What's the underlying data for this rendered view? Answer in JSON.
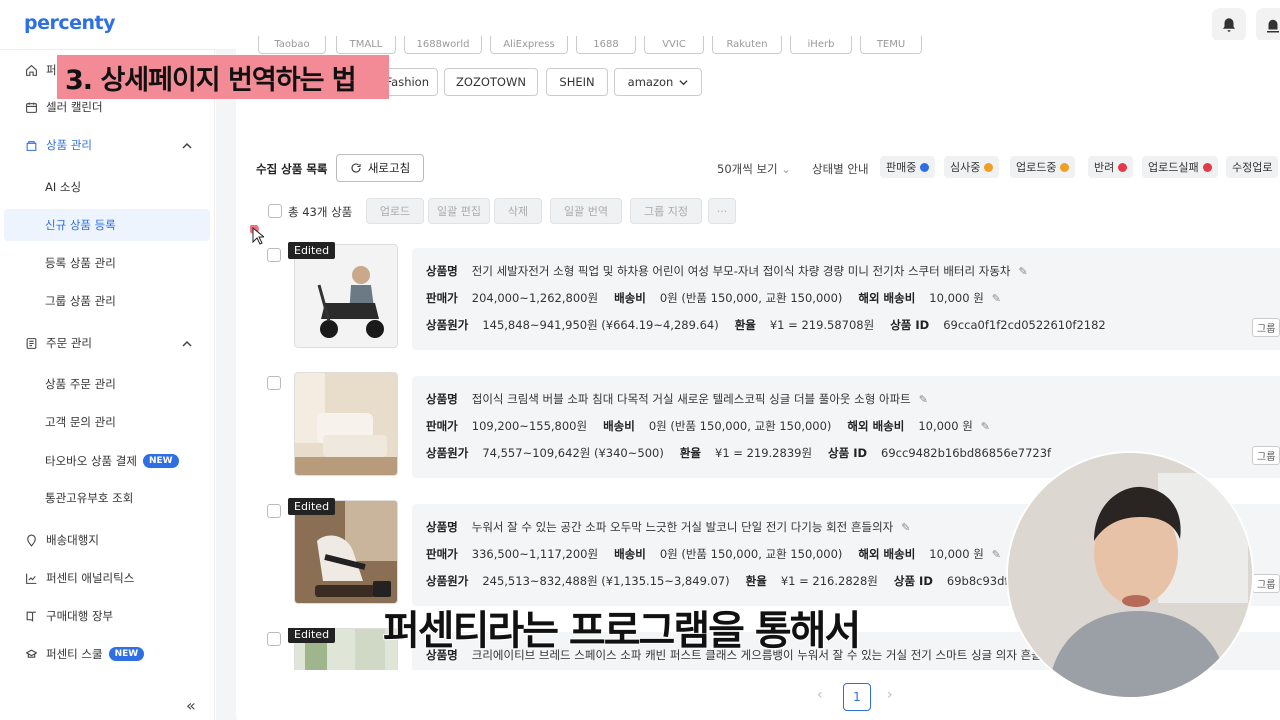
{
  "app": {
    "logo": "percenty"
  },
  "sidebar": {
    "items": [
      {
        "label": "퍼센티 홈",
        "icon": "home-icon"
      },
      {
        "label": "셀러 캘린더",
        "icon": "calendar-icon"
      },
      {
        "label": "상품 관리",
        "icon": "box-icon",
        "active": true
      },
      {
        "label": "AI 소싱"
      },
      {
        "label": "신규 상품 등록",
        "selected": true
      },
      {
        "label": "등록 상품 관리"
      },
      {
        "label": "그룹 상품 관리"
      },
      {
        "label": "주문 관리",
        "icon": "order-icon"
      },
      {
        "label": "상품 주문 관리"
      },
      {
        "label": "고객 문의 관리"
      },
      {
        "label": "타오바오 상품 결제",
        "badge": "NEW"
      },
      {
        "label": "통관고유부호 조회"
      },
      {
        "label": "배송대행지",
        "icon": "pin-icon"
      },
      {
        "label": "퍼센티 애널리틱스",
        "icon": "chart-icon"
      },
      {
        "label": "구매대행 장부",
        "icon": "book-icon"
      },
      {
        "label": "퍼센티 스쿨",
        "icon": "school-icon",
        "badge": "NEW"
      }
    ]
  },
  "filters": {
    "top_chips": [
      "Taobao",
      "TMALL",
      "1688world",
      "AliExpress",
      "1688",
      "VVIC",
      "Rakuten",
      "iHerb",
      "TEMU"
    ],
    "chips": [
      "Fashion",
      "ZOZOTOWN",
      "SHEIN",
      "amazon"
    ]
  },
  "list": {
    "title": "수집 상품 목록",
    "refresh": "새로고침",
    "per_page": "50개씩 보기",
    "status_guide": "상태별 안내",
    "statuses": [
      {
        "label": "판매중",
        "color": "#2f6fe4"
      },
      {
        "label": "심사중",
        "color": "#f0a020"
      },
      {
        "label": "업로드중",
        "color": "#f0a020"
      },
      {
        "label": "반려",
        "color": "#e53948"
      },
      {
        "label": "업로드실패",
        "color": "#e53948"
      },
      {
        "label": "수정업로"
      }
    ],
    "total": "총 43개 상품",
    "bulk_actions": [
      "업로드",
      "일괄 편집",
      "삭제",
      "일괄 번역",
      "그룹 지정",
      "···"
    ]
  },
  "labels": {
    "name": "상품명",
    "price": "판매가",
    "shipping": "배송비",
    "overseas": "해외 배송비",
    "cost": "상품원가",
    "rate": "환율",
    "id": "상품 ID",
    "group": "그룹",
    "edited": "Edited"
  },
  "products": [
    {
      "name": "전기 세발자전거 소형 픽업 및 하차용 어린이 여성 부모-자녀 접이식 차량 경량 미니 전기차 스쿠터 배터리 자동차",
      "price": "204,000~1,262,800원",
      "shipping": "0원 (반품 150,000, 교환 150,000)",
      "overseas": "10,000 원",
      "cost": "145,848~941,950원 (¥664.19~4,289.64)",
      "rate": "¥1 = 219.58708원",
      "id": "69cca0f1f2cd0522610f2182",
      "edited": true
    },
    {
      "name": "접이식 크림색 버블 소파 침대 다목적 거실 새로운 텔레스코픽 싱글 더블 풀아웃 소형 아파트",
      "price": "109,200~155,800원",
      "shipping": "0원 (반품 150,000, 교환 150,000)",
      "overseas": "10,000 원",
      "cost": "74,557~109,642원 (¥340~500)",
      "rate": "¥1 = 219.2839원",
      "id": "69cc9482b16bd86856e7723f",
      "edited": false
    },
    {
      "name": "누워서 잘 수 있는 공간 소파 오두막 느긋한 거실 발코니 단일 전기 다기능 회전 흔들의자",
      "price": "336,500~1,117,200원",
      "shipping": "0원 (반품 150,000, 교환 150,000)",
      "overseas": "10,000 원",
      "cost": "245,513~832,488원 (¥1,135.15~3,849.07)",
      "rate": "¥1 = 216.2828원",
      "id": "69b8c93df2cd",
      "edited": true
    },
    {
      "name": "크리에이티브 브레드 스페이스 소파 캐빈 퍼스트 클래스 게으름뱅이 누워서 잘 수 있는 거실 전기 스마트 싱글 의자 흔들의",
      "edited": true
    }
  ],
  "pagination": {
    "current": "1"
  },
  "overlay": {
    "title": "3. 상세페이지 번역하는 법",
    "subtitle": "퍼센티라는 프로그램을 통해서"
  }
}
